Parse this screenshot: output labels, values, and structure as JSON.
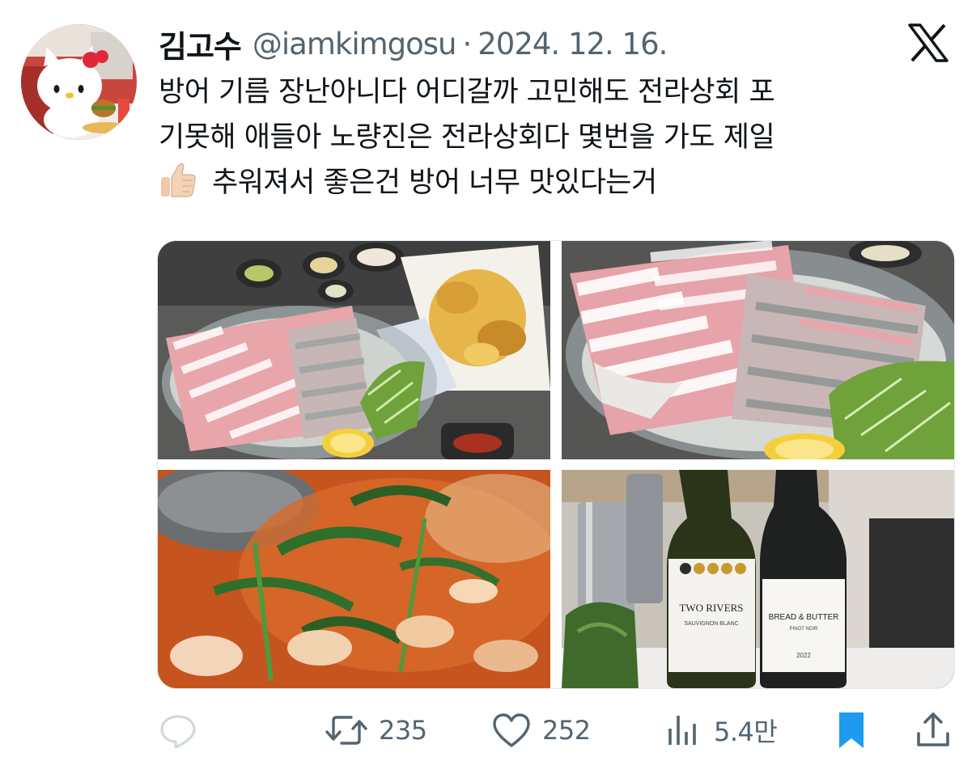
{
  "tweet": {
    "author": {
      "display_name": "김고수",
      "handle": "@iamkimgosu",
      "avatar_icon": "hello-kitty-avatar"
    },
    "separator": "·",
    "date": "2024. 12. 16.",
    "text_line1": "방어 기름 장난아니다 어디갈까 고민해도 전라상회 포",
    "text_line2": "기못해 애들아 노량진은 전라상회다 몇번을 가도 제일",
    "text_line3": "추워져서 좋은건 방어 너무 맛있다는거",
    "text_emoji": "thumbs-up-emoji",
    "photos": [
      {
        "name": "sashimi-platter-with-fries"
      },
      {
        "name": "sashimi-platter-closeup"
      },
      {
        "name": "spicy-fish-stew"
      },
      {
        "name": "wine-bottles",
        "label_1": "TWO RIVERS",
        "label_1_sub": "SAUVIGNON BLANC",
        "label_2": "BREAD & BUTTER",
        "label_2_sub": "PINOT NOIR",
        "label_2_year": "2022"
      }
    ]
  },
  "actions": {
    "reply": {
      "icon": "reply-icon",
      "count": ""
    },
    "retweet": {
      "icon": "retweet-icon",
      "count": "235"
    },
    "like": {
      "icon": "heart-icon",
      "count": "252"
    },
    "views": {
      "icon": "views-icon",
      "count": "5.4만"
    },
    "bookmark": {
      "icon": "bookmark-icon"
    },
    "share": {
      "icon": "share-icon"
    }
  },
  "colors": {
    "secondary_text": "#536471",
    "bookmark_active": "#1d9bf0",
    "text": "#0f1419"
  }
}
